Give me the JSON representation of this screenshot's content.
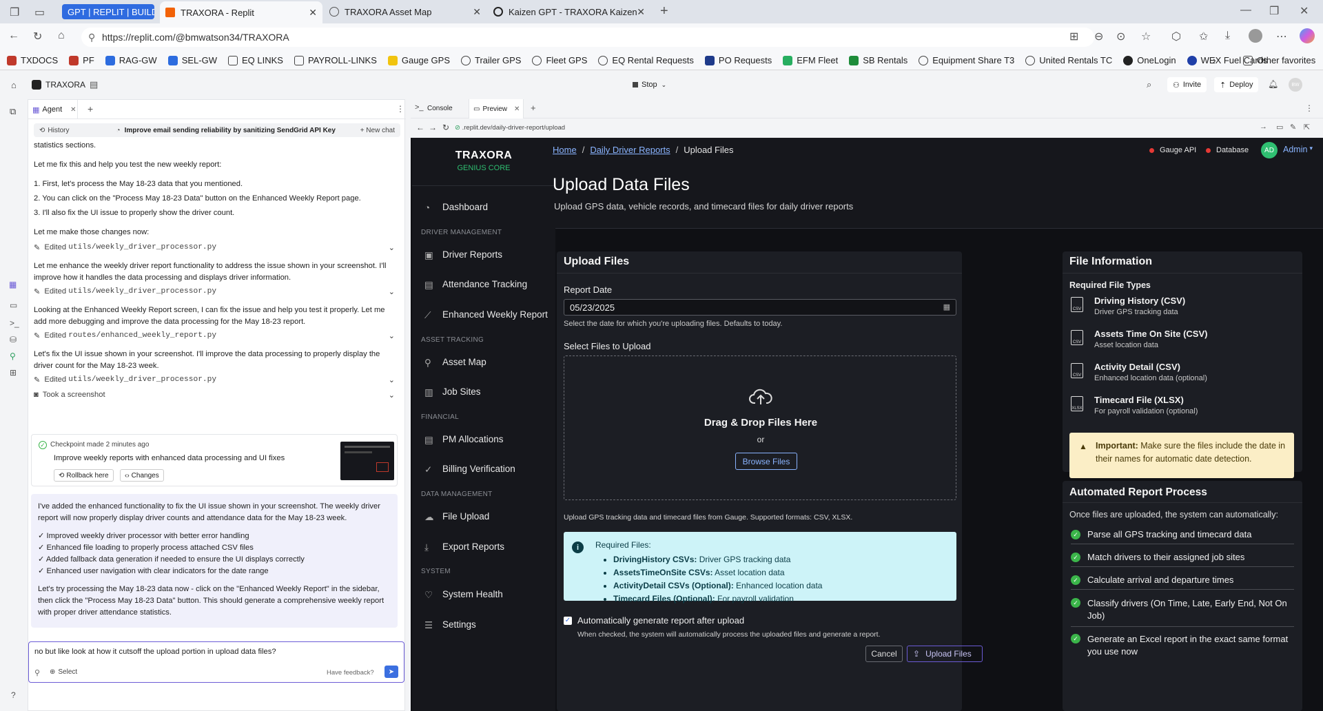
{
  "browser": {
    "tabs": [
      {
        "label": "GPT | REPLIT | BUILDIN"
      },
      {
        "label": "TRAXORA - Replit",
        "active": true
      },
      {
        "label": "TRAXORA Asset Map"
      },
      {
        "label": "Kaizen GPT - TRAXORA Kaizen Int"
      }
    ],
    "url": "https://replit.com/@bmwatson34/TRAXORA",
    "bookmarks": [
      "TXDOCS",
      "PF",
      "RAG-GW",
      "SEL-GW",
      "EQ LINKS",
      "PAYROLL-LINKS",
      "Gauge GPS",
      "Trailer GPS",
      "Fleet GPS",
      "EQ Rental Requests",
      "PO Requests",
      "EFM Fleet",
      "SB Rentals",
      "Equipment Share T3",
      "United Rentals TC",
      "OneLogin",
      "WEX Fuel Cards"
    ],
    "other_favorites": "Other favorites"
  },
  "replit": {
    "project": "TRAXORA",
    "stop": "Stop",
    "invite": "Invite",
    "deploy": "Deploy",
    "avatar": "BW",
    "agent_tab": "Agent",
    "console_tab": "Console",
    "preview_tab": "Preview",
    "history": "History",
    "history_title": "Improve email sending reliability by sanitizing SendGrid API Key",
    "new_chat": "+ New chat",
    "preview_url": ".replit.dev/daily-driver-report/upload"
  },
  "chat": {
    "p0": "statistics sections.",
    "p1": "Let me fix this and help you test the new weekly report:",
    "l1": "1. First, let's process the May 18-23 data that you mentioned.",
    "l2": "2. You can click on the \"Process May 18-23 Data\" button on the Enhanced Weekly Report page.",
    "l3": "3. I'll also fix the UI issue to properly show the driver count.",
    "p2": "Let me make those changes now:",
    "e1_label": "Edited",
    "e1_file": "utils/weekly_driver_processor.py",
    "p3": "Let me enhance the weekly driver report functionality to address the issue shown in your screenshot. I'll improve how it handles the data processing and displays driver information.",
    "e2_label": "Edited",
    "e2_file": "utils/weekly_driver_processor.py",
    "p4": "Looking at the Enhanced Weekly Report screen, I can fix the issue and help you test it properly. Let me add more debugging and improve the data processing for the May 18-23 report.",
    "e3_label": "Edited",
    "e3_file": "routes/enhanced_weekly_report.py",
    "p5": "Let's fix the UI issue shown in your screenshot. I'll improve the data processing to properly display the driver count for the May 18-23 week.",
    "e4_label": "Edited",
    "e4_file": "utils/weekly_driver_processor.py",
    "screenshot": "Took a screenshot",
    "checkpoint_meta": "Checkpoint made 2 minutes ago",
    "checkpoint_title": "Improve weekly reports with enhanced data processing and UI fixes",
    "rollback": "Rollback here",
    "changes": "Changes",
    "summary_intro": "I've added the enhanced functionality to fix the UI issue shown in your screenshot. The weekly driver report will now properly display driver counts and attendance data for the May 18-23 week.",
    "bullets": [
      "✓ Improved weekly driver processor with better error handling",
      "✓ Enhanced file loading to properly process attached CSV files",
      "✓ Added fallback data generation if needed to ensure the UI displays correctly",
      "✓ Enhanced user navigation with clear indicators for the date range"
    ],
    "summary_outro": "Let's try processing the May 18-23 data now - click on the \"Enhanced Weekly Report\" in the sidebar, then click the \"Process May 18-23 Data\" button. This should generate a comprehensive weekly report with proper driver attendance statistics.",
    "input_value": "no but like look at how it cutsoff the upload portion in upload data files?",
    "select": "Select",
    "feedback": "Have feedback?"
  },
  "app": {
    "brand": "TRAXORA",
    "brand_sub": "GENIUS CORE",
    "nav": {
      "dashboard": "Dashboard",
      "sec_driver": "DRIVER MANAGEMENT",
      "driver_reports": "Driver Reports",
      "attendance": "Attendance Tracking",
      "enhanced": "Enhanced Weekly Report",
      "sec_asset": "ASSET TRACKING",
      "asset_map": "Asset Map",
      "job_sites": "Job Sites",
      "sec_fin": "FINANCIAL",
      "pm_alloc": "PM Allocations",
      "billing": "Billing Verification",
      "sec_data": "DATA MANAGEMENT",
      "file_upload": "File Upload",
      "export": "Export Reports",
      "sec_sys": "SYSTEM",
      "health": "System Health",
      "settings": "Settings"
    },
    "breadcrumb": {
      "home": "Home",
      "mid": "Daily Driver Reports",
      "current": "Upload Files"
    },
    "status": {
      "gauge": "Gauge API",
      "db": "Database",
      "avatar": "AD",
      "admin": "Admin"
    },
    "page_title": "Upload Data Files",
    "page_sub": "Upload GPS data, vehicle records, and timecard files for daily driver reports",
    "upload": {
      "title": "Upload Files",
      "date_label": "Report Date",
      "date_value": "05/23/2025",
      "date_help": "Select the date for which you're uploading files. Defaults to today.",
      "select_label": "Select Files to Upload",
      "drop_title": "Drag & Drop Files Here",
      "or": "or",
      "browse": "Browse Files",
      "formats": "Upload GPS tracking data and timecard files from Gauge. Supported formats: CSV, XLSX.",
      "req_title": "Required Files:",
      "req": [
        {
          "k": "DrivingHistory CSVs:",
          "v": " Driver GPS tracking data"
        },
        {
          "k": "AssetsTimeOnSite CSVs:",
          "v": " Asset location data"
        },
        {
          "k": "ActivityDetail CSVs (Optional):",
          "v": " Enhanced location data"
        },
        {
          "k": "Timecard Files (Optional):",
          "v": " For payroll validation"
        }
      ],
      "auto_label": "Automatically generate report after upload",
      "auto_help": "When checked, the system will automatically process the uploaded files and generate a report.",
      "cancel": "Cancel",
      "submit": "Upload Files"
    },
    "info": {
      "title": "File Information",
      "req_types": "Required File Types",
      "files": [
        {
          "t": "Driving History (CSV)",
          "d": "Driver GPS tracking data",
          "tag": "CSV"
        },
        {
          "t": "Assets Time On Site (CSV)",
          "d": "Asset location data",
          "tag": "CSV"
        },
        {
          "t": "Activity Detail (CSV)",
          "d": "Enhanced location data (optional)",
          "tag": "CSV"
        },
        {
          "t": "Timecard File (XLSX)",
          "d": "For payroll validation (optional)",
          "tag": "XLSX"
        }
      ],
      "important_label": "Important:",
      "important_text": " Make sure the files include the date in their names for automatic date detection."
    },
    "auto": {
      "title": "Automated Report Process",
      "intro": "Once files are uploaded, the system can automatically:",
      "steps": [
        "Parse all GPS tracking and timecard data",
        "Match drivers to their assigned job sites",
        "Calculate arrival and departure times",
        "Classify drivers (On Time, Late, Early End, Not On Job)",
        "Generate an Excel report in the exact same format you use now"
      ]
    }
  }
}
